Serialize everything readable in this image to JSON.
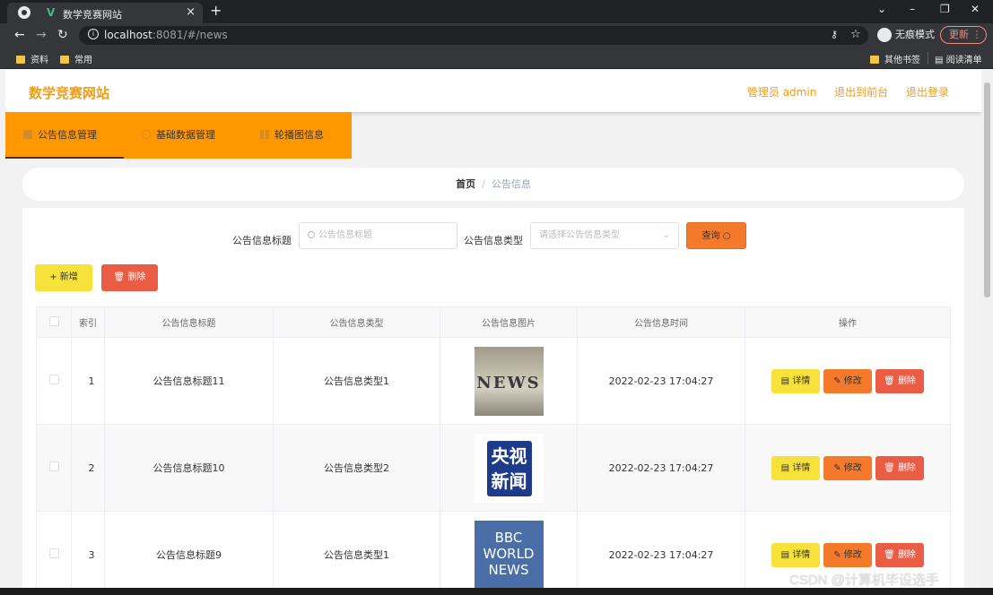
{
  "browser": {
    "tab_title": "数学竞赛网站",
    "tab_close": "×",
    "new_tab": "+",
    "url_host": "localhost",
    "url_path": ":8081/#/news",
    "incognito_label": "无痕模式",
    "update_label": "更新",
    "bookmarks": [
      "资料",
      "常用"
    ],
    "other_bookmarks": "其他书签",
    "reading_list": "阅读清单"
  },
  "header": {
    "site_title": "数学竞赛网站",
    "admin_label": "管理员 admin",
    "back_to_front": "退出到前台",
    "logout": "退出登录"
  },
  "menu": {
    "items": [
      {
        "label": "公告信息管理",
        "icon": "home-icon",
        "active": true
      },
      {
        "label": "基础数据管理",
        "icon": "circle-icon"
      },
      {
        "label": "轮播图信息",
        "icon": "grid-icon"
      }
    ]
  },
  "breadcrumb": {
    "home": "首页",
    "separator": "/",
    "current": "公告信息"
  },
  "search": {
    "title_label": "公告信息标题",
    "title_placeholder": "公告信息标题",
    "type_label": "公告信息类型",
    "type_placeholder": "请选择公告信息类型",
    "query_button": "查询"
  },
  "actions": {
    "add": "+ 新增",
    "delete": "删除"
  },
  "table": {
    "columns": [
      "索引",
      "公告信息标题",
      "公告信息类型",
      "公告信息图片",
      "公告信息时间",
      "操作"
    ],
    "rows": [
      {
        "index": "1",
        "title": "公告信息标题11",
        "type": "公告信息类型1",
        "image": "news-blocks",
        "time": "2022-02-23 17:04:27"
      },
      {
        "index": "2",
        "title": "公告信息标题10",
        "type": "公告信息类型2",
        "image": "cctv-news-logo",
        "time": "2022-02-23 17:04:27"
      },
      {
        "index": "3",
        "title": "公告信息标题9",
        "type": "公告信息类型1",
        "image": "bbc-world-news-logo",
        "time": "2022-02-23 17:04:27"
      }
    ],
    "row_actions": {
      "detail": "详情",
      "edit": "修改",
      "delete": "删除"
    }
  },
  "images": {
    "news_text": "NEWS",
    "cctv_text_1": "央视",
    "cctv_text_2": "新闻",
    "bbc_text_1": "BBC",
    "bbc_text_2": "WORLD",
    "bbc_text_3": "NEWS"
  },
  "watermark": "CSDN @计算机毕设选手"
}
